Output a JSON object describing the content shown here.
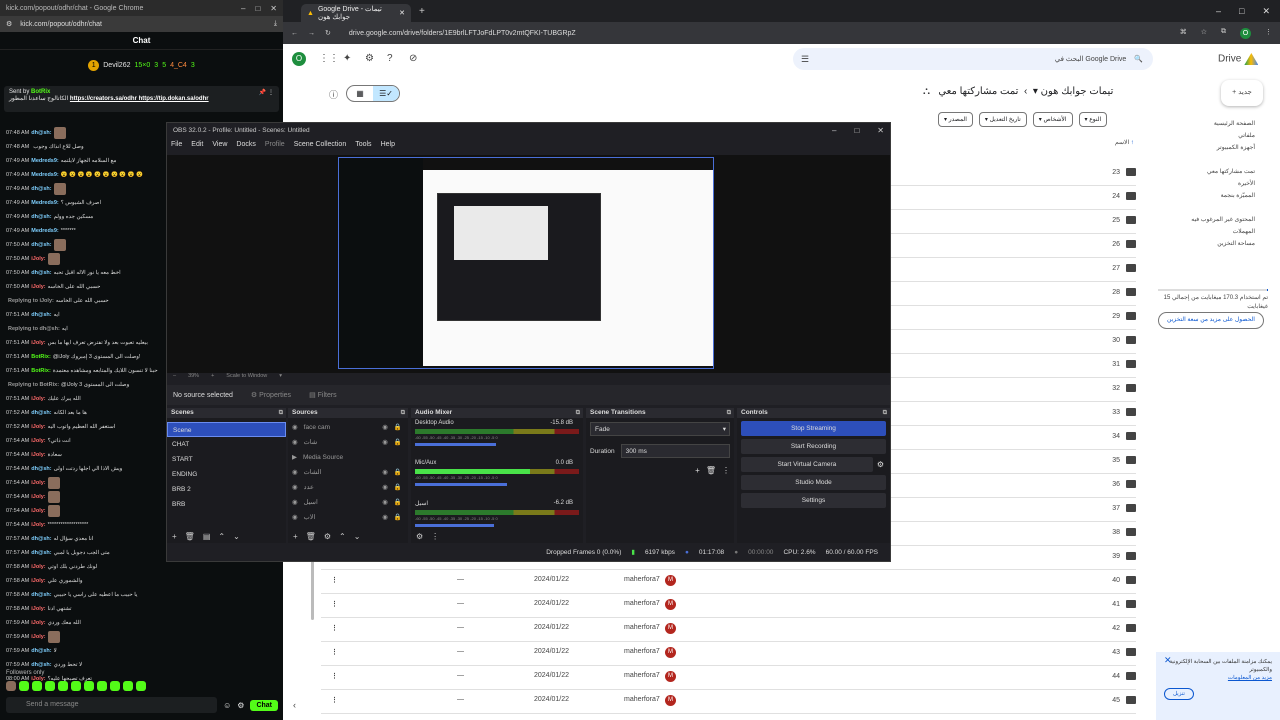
{
  "kick": {
    "title_url": "kick.com/popout/odhr/chat - Google Chrome",
    "address": "kick.com/popout/odhr/chat",
    "chat_heading": "Chat",
    "leader_name": "Devil262",
    "leader_stat": "15×0",
    "leader_num": "3",
    "leader_sub_a": "5",
    "leader_sub_b": "4_C4",
    "leader_sub_c": "3",
    "pin_sender_prefix": "Sent by",
    "pin_sender": "BotRix",
    "pin_text": "الكاتالوج ساعدنا المطور",
    "pin_links": "https://creators.sa/odhr https://tip.dokan.sa/odhr",
    "messages": [
      {
        "time": "07:48 AM",
        "user": "dh@sh:",
        "color": "#7fd0ff",
        "text": "",
        "emote": true
      },
      {
        "time": "07:48 AM",
        "user": "",
        "color": "#fff",
        "text": "وصل للاع انذاك وجوب",
        "emote": false
      },
      {
        "time": "07:49 AM",
        "user": "Medreds9:",
        "color": "#7fd0ff",
        "text": "مع السلامه الجهاز لايلتمه",
        "emote": false
      },
      {
        "time": "07:49 AM",
        "user": "Medreds9:",
        "color": "#7fd0ff",
        "text": "😮 😮 😮 😮 😮 😮 😮 😮 😮 😮",
        "emote": false
      },
      {
        "time": "07:49 AM",
        "user": "dh@sh:",
        "color": "#7fd0ff",
        "text": "",
        "emote": true
      },
      {
        "time": "07:49 AM",
        "user": "Medreds9:",
        "color": "#7fd0ff",
        "text": "اصرف الشيوس ؟",
        "emote": false
      },
      {
        "time": "07:49 AM",
        "user": "dh@sh:",
        "color": "#7fd0ff",
        "text": "مسكين جده وولم",
        "emote": false
      },
      {
        "time": "07:49 AM",
        "user": "Medreds9:",
        "color": "#7fd0ff",
        "text": "*******",
        "emote": false
      },
      {
        "time": "07:50 AM",
        "user": "dh@sh:",
        "color": "#7fd0ff",
        "text": "",
        "emote": true
      },
      {
        "time": "07:50 AM",
        "user": "iJoly:",
        "color": "#ff6b6b",
        "text": "",
        "emote": true
      },
      {
        "time": "07:50 AM",
        "user": "dh@sh:",
        "color": "#7fd0ff",
        "text": "اخط معه يا نور الاله اقبل تحبه",
        "emote": false
      },
      {
        "time": "07:50 AM",
        "user": "iJoly:",
        "color": "#ff6b6b",
        "text": "حسبي الله على الخاسه",
        "emote": false
      },
      {
        "time": "",
        "user": "Replying to iJoly:",
        "color": "#999",
        "text": "حسبي الله على الخاسه",
        "emote": false
      },
      {
        "time": "07:51 AM",
        "user": "dh@sh:",
        "color": "#7fd0ff",
        "text": "ايه",
        "emote": false
      },
      {
        "time": "",
        "user": "Replying to dh@sh:",
        "color": "#999",
        "text": "ايه",
        "emote": false
      },
      {
        "time": "07:51 AM",
        "user": "iJoly:",
        "color": "#ff6b6b",
        "text": "بيعليه تعبوت بعد ولا تفترض تعرف ايها ما بس",
        "emote": false
      },
      {
        "time": "07:51 AM",
        "user": "BotRix:",
        "color": "#53fc18",
        "text": "@iJoly وصلت الى المستوى 3 إمبروك!",
        "emote": false
      },
      {
        "time": "07:51 AM",
        "user": "BotRix:",
        "color": "#53fc18",
        "text": "حبنا لا تنسون اللايك والمتابعه ومشاهده معتمدة",
        "emote": false
      },
      {
        "time": "",
        "user": "Replying to BotRix:",
        "color": "#999",
        "text": "@iJoly وصلت الى المستوى 3",
        "emote": false
      },
      {
        "time": "07:51 AM",
        "user": "iJoly:",
        "color": "#ff6b6b",
        "text": "الله يبرك عليك",
        "emote": false
      },
      {
        "time": "07:52 AM",
        "user": "dh@sh:",
        "color": "#7fd0ff",
        "text": "ها ما بعد الكانه",
        "emote": false
      },
      {
        "time": "07:52 AM",
        "user": "iJoly:",
        "color": "#ff6b6b",
        "text": "استغفر الله العظيم واتوب اليه",
        "emote": false
      },
      {
        "time": "07:54 AM",
        "user": "iJoly:",
        "color": "#ff6b6b",
        "text": "انت ذاتي؟",
        "emote": false
      },
      {
        "time": "07:54 AM",
        "user": "iJoly:",
        "color": "#ff6b6b",
        "text": "سعادة",
        "emote": false
      },
      {
        "time": "07:54 AM",
        "user": "dh@sh:",
        "color": "#7fd0ff",
        "text": "ويش الاذا الي اجلها ردتت اولى",
        "emote": false
      },
      {
        "time": "07:54 AM",
        "user": "iJoly:",
        "color": "#ff6b6b",
        "text": "",
        "emote": true
      },
      {
        "time": "07:54 AM",
        "user": "iJoly:",
        "color": "#ff6b6b",
        "text": "",
        "emote": true
      },
      {
        "time": "07:54 AM",
        "user": "iJoly:",
        "color": "#ff6b6b",
        "text": "",
        "emote": true
      },
      {
        "time": "07:54 AM",
        "user": "iJoly:",
        "color": "#ff6b6b",
        "text": "*******************",
        "emote": false
      },
      {
        "time": "07:57 AM",
        "user": "dh@sh:",
        "color": "#7fd0ff",
        "text": "انا معدي سؤال له",
        "emote": false
      },
      {
        "time": "07:57 AM",
        "user": "dh@sh:",
        "color": "#7fd0ff",
        "text": "متى الجب دجوبل يا لمبي",
        "emote": false
      },
      {
        "time": "07:58 AM",
        "user": "iJoly:",
        "color": "#ff6b6b",
        "text": "لونك طردني بلك اوتي",
        "emote": false
      },
      {
        "time": "07:58 AM",
        "user": "iJoly:",
        "color": "#ff6b6b",
        "text": "والشموري علي",
        "emote": false
      },
      {
        "time": "07:58 AM",
        "user": "dh@sh:",
        "color": "#7fd0ff",
        "text": "يا حبيب ما اعطيه على راسي يا حبيبي",
        "emote": false
      },
      {
        "time": "07:58 AM",
        "user": "iJoly:",
        "color": "#ff6b6b",
        "text": "تشتهي ادنا",
        "emote": false
      },
      {
        "time": "07:59 AM",
        "user": "iJoly:",
        "color": "#ff6b6b",
        "text": "الله معك وردي",
        "emote": false
      },
      {
        "time": "07:59 AM",
        "user": "iJoly:",
        "color": "#ff6b6b",
        "text": "",
        "emote": true
      },
      {
        "time": "07:59 AM",
        "user": "dh@sh:",
        "color": "#7fd0ff",
        "text": "لا",
        "emote": false
      },
      {
        "time": "07:59 AM",
        "user": "dh@sh:",
        "color": "#7fd0ff",
        "text": "لا تحط وردي",
        "emote": false
      },
      {
        "time": "08:00 AM",
        "user": "iJoly:",
        "color": "#ff6b6b",
        "text": "تعرف تصبحها عليه؟",
        "emote": false
      }
    ],
    "followers_only": "Followers only",
    "input_placeholder": "Send a message",
    "chat_button": "Chat"
  },
  "chrome": {
    "tab_title": "Google Drive - تيمات جوابك هون",
    "url": "drive.google.com/drive/folders/1E9brlLFTJoFdLPT0v2mtQFKI-TUBGRpZ",
    "avatar_letter": "O"
  },
  "drive": {
    "search_placeholder": "البحث في Google Drive",
    "logo_text": "Drive",
    "new_button": "جديد",
    "breadcrumb_root": "تمت مشاركتها معي",
    "breadcrumb_folder": "تيمات جوابك هون",
    "filter_type": "النوع",
    "filter_people": "الأشخاص",
    "filter_modified": "تاريخ التعديل",
    "filter_source": "المصدر",
    "name_header": "الاسم",
    "sidebar": [
      "الصفحة الرئيسية",
      "ملفاتي",
      "أجهزة الكمبيوتر",
      "",
      "تمت مشاركتها معي",
      "الأخيرة",
      "المميّزة بنجمة",
      "",
      "المحتوى غير المرغوب فيه",
      "المهملات",
      "مساحة التخزين"
    ],
    "storage_text": "تم استخدام 170.3 ميغابايت من إجمالي 15 غيغابايت",
    "storage_fraction": 0.011,
    "get_more": "الحصول على مزيد من سعة التخزين",
    "rows": [
      {
        "num": "23",
        "date": "",
        "owner": ""
      },
      {
        "num": "24",
        "date": "",
        "owner": ""
      },
      {
        "num": "25",
        "date": "",
        "owner": ""
      },
      {
        "num": "26",
        "date": "",
        "owner": ""
      },
      {
        "num": "27",
        "date": "",
        "owner": ""
      },
      {
        "num": "28",
        "date": "",
        "owner": ""
      },
      {
        "num": "29",
        "date": "",
        "owner": ""
      },
      {
        "num": "30",
        "date": "",
        "owner": ""
      },
      {
        "num": "31",
        "date": "",
        "owner": ""
      },
      {
        "num": "32",
        "date": "",
        "owner": ""
      },
      {
        "num": "33",
        "date": "",
        "owner": ""
      },
      {
        "num": "34",
        "date": "",
        "owner": ""
      },
      {
        "num": "35",
        "date": "",
        "owner": ""
      },
      {
        "num": "36",
        "date": "",
        "owner": ""
      },
      {
        "num": "37",
        "date": "",
        "owner": ""
      },
      {
        "num": "38",
        "date": "",
        "owner": ""
      },
      {
        "num": "39",
        "date": "",
        "owner": ""
      },
      {
        "num": "40",
        "date": "2024/01/22",
        "owner": "maherfora7"
      },
      {
        "num": "41",
        "date": "2024/01/22",
        "owner": "maherfora7"
      },
      {
        "num": "42",
        "date": "2024/01/22",
        "owner": "maherfora7"
      },
      {
        "num": "43",
        "date": "2024/01/22",
        "owner": "maherfora7"
      },
      {
        "num": "44",
        "date": "2024/01/22",
        "owner": "maherfora7"
      },
      {
        "num": "45",
        "date": "2024/01/22",
        "owner": "maherfora7"
      }
    ],
    "owner_initial": "M",
    "dash": "—",
    "notify_text": "يمكنك مزامنة الملفات بين السحابة الإلكترونية والكمبيوتر",
    "notify_link": "مزيد من المعلومات",
    "notify_button": "تنزيل"
  },
  "obs": {
    "title": "OBS 32.0.2 - Profile: Untitled - Scenes: Untitled",
    "menu": [
      "File",
      "Edit",
      "View",
      "Docks",
      "Profile",
      "Scene Collection",
      "Tools",
      "Help"
    ],
    "zoom": "39%",
    "scale": "Scale to Window",
    "no_source": "No source selected",
    "properties": "Properties",
    "filters": "Filters",
    "scenes_title": "Scenes",
    "scenes": [
      "Scene",
      "CHAT",
      "START",
      "ENDING",
      "BRB 2",
      "BRB"
    ],
    "sources_title": "Sources",
    "sources": [
      "face cam",
      "شات",
      "Media Source",
      "الشات",
      "عدد",
      "اسيل",
      "الاب"
    ],
    "mixer_title": "Audio Mixer",
    "mixer": [
      {
        "name": "Desktop Audio",
        "db": "-15.8 dB",
        "level": 0.62
      },
      {
        "name": "Mic/Aux",
        "db": "0.0 dB",
        "level": 0.7
      },
      {
        "name": "اسيل",
        "db": "-6.2 dB",
        "level": 0.6
      }
    ],
    "ticks": "-60 -55 -50 -45 -40 -35 -30 -25 -20 -15 -10 -5 0",
    "transitions_title": "Scene Transitions",
    "transition": "Fade",
    "duration_label": "Duration",
    "duration": "300 ms",
    "controls_title": "Controls",
    "controls": [
      "Stop Streaming",
      "Start Recording",
      "Start Virtual Camera",
      "Studio Mode",
      "Settings"
    ],
    "status": {
      "dropped": "Dropped Frames 0 (0.0%)",
      "kbps": "6197 kbps",
      "stream_time": "01:17:08",
      "rec_time": "00:00:00",
      "cpu": "CPU: 2.6%",
      "fps": "60.00 / 60.00 FPS"
    }
  }
}
